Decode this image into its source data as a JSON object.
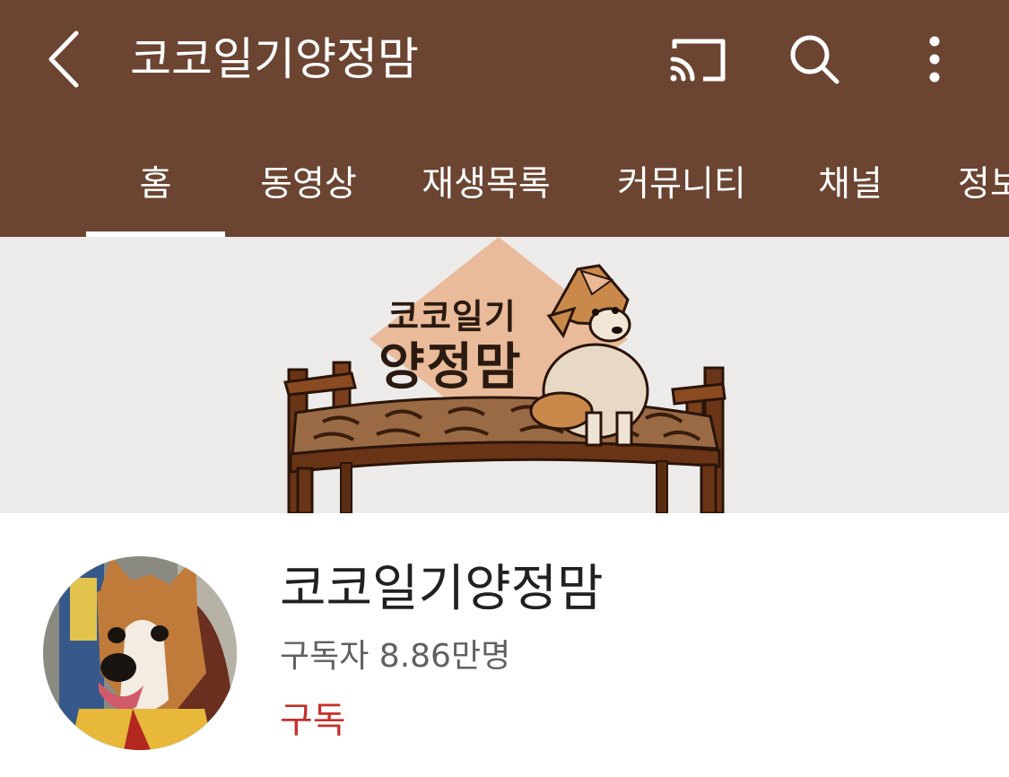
{
  "header": {
    "title": "코코일기양정맘",
    "back_icon": "back-arrow-icon",
    "cast_icon": "cast-icon",
    "search_icon": "search-icon",
    "more_icon": "more-vert-icon"
  },
  "tabs": [
    {
      "label": "홈",
      "active": true
    },
    {
      "label": "동영상"
    },
    {
      "label": "재생목록"
    },
    {
      "label": "커뮤니티"
    },
    {
      "label": "채널"
    },
    {
      "label": "정보"
    }
  ],
  "banner": {
    "line1": "코코일기",
    "line2": "양정맘"
  },
  "channel": {
    "name": "코코일기양정맘",
    "subscribers": "구독자 8.86만명",
    "subscribe_label": "구독"
  },
  "colors": {
    "header_bg": "#6b4532",
    "subscribe": "#c4302b",
    "banner_bg": "#ecebea"
  }
}
